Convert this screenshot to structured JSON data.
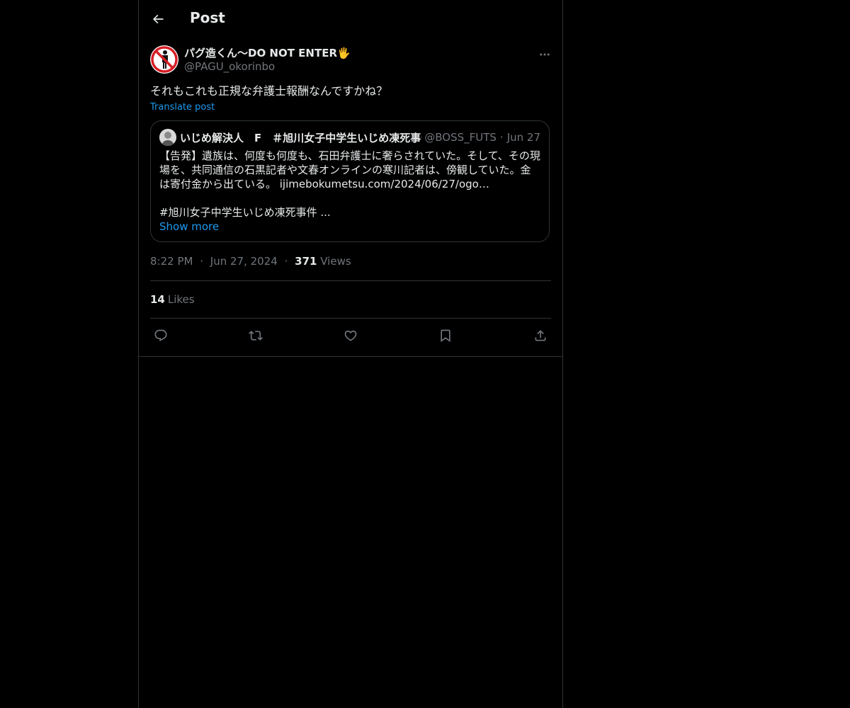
{
  "header": {
    "title": "Post"
  },
  "post": {
    "author_name": "パグ造くん〜DO NOT ENTER🖐",
    "author_handle": "@PAGU_okorinbo",
    "text": "それもこれも正規な弁護士報酬なんですかね？",
    "translate_label": "Translate post",
    "time": "8:22 PM",
    "date": "Jun 27, 2024",
    "views_count": "371",
    "views_label": "Views",
    "likes_count": "14",
    "likes_label": "Likes"
  },
  "quote": {
    "author_name": "いじめ解決人　F　＃旭川女子中学生いじめ凍死事件",
    "author_handle": "@BOSS_FUTS",
    "date": "Jun 27",
    "body": "【告発】遺族は、何度も何度も、石田弁護士に奢らされていた。そして、その現場を、共同通信の石黒記者や文春オンラインの寒川記者は、傍観していた。金は寄付金から出ている。 ijimebokumetsu.com/2024/06/27/ogo…",
    "hashtag_line": "#旭川女子中学生いじめ凍死事件 ...",
    "show_more": "Show more"
  },
  "separator": "·",
  "icons": {
    "back": "arrow-left-icon",
    "more": "more-horizontal-icon",
    "reply": "reply-icon",
    "retweet": "retweet-icon",
    "like": "heart-icon",
    "bookmark": "bookmark-icon",
    "share": "share-icon"
  },
  "colors": {
    "background": "#000000",
    "text": "#e7e9ea",
    "secondary": "#71767b",
    "accent": "#1d9bf0",
    "border": "#2f3336"
  }
}
